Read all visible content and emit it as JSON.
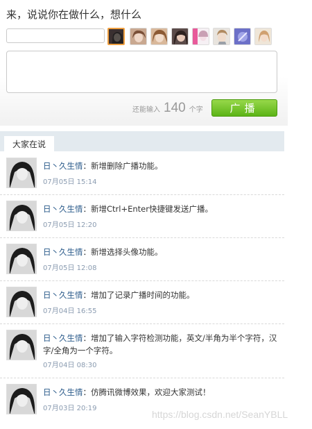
{
  "compose": {
    "prompt": "来，说说你在做什么，想什么",
    "name_input_value": "",
    "message_value": "",
    "remaining_label": "还能输入",
    "remaining_count": "140",
    "remaining_unit": "个字",
    "send_label": "广播"
  },
  "avatars": [
    {
      "icon": "avatar-1",
      "selected": true
    },
    {
      "icon": "avatar-2",
      "selected": false
    },
    {
      "icon": "avatar-3",
      "selected": false
    },
    {
      "icon": "avatar-4",
      "selected": false
    },
    {
      "icon": "avatar-5",
      "selected": false
    },
    {
      "icon": "avatar-6",
      "selected": false
    },
    {
      "icon": "avatar-7",
      "selected": false
    },
    {
      "icon": "avatar-8",
      "selected": false
    }
  ],
  "feed": {
    "tab_label": "大家在说",
    "posts": [
      {
        "user": "日丶久生情",
        "sep": "：",
        "text": "新增删除广播功能。",
        "time": "07月05日 15:14"
      },
      {
        "user": "日丶久生情",
        "sep": "：",
        "text": "新增Ctrl+Enter快捷键发送广播。",
        "time": "07月05日 12:20"
      },
      {
        "user": "日丶久生情",
        "sep": "：",
        "text": "新增选择头像功能。",
        "time": "07月05日 12:08"
      },
      {
        "user": "日丶久生情",
        "sep": "：",
        "text": "增加了记录广播时间的功能。",
        "time": "07月04日 16:55"
      },
      {
        "user": "日丶久生情",
        "sep": "：",
        "text": "增加了输入字符检测功能，英文/半角为半个字符，汉字/全角为一个字符。",
        "time": "07月04日 08:30"
      },
      {
        "user": "日丶久生情",
        "sep": "：",
        "text": "仿腾讯微博效果，欢迎大家测试！",
        "time": "07月03日 20:19"
      }
    ]
  },
  "watermark": "https://blog.csdn.net/SeanYBLL"
}
